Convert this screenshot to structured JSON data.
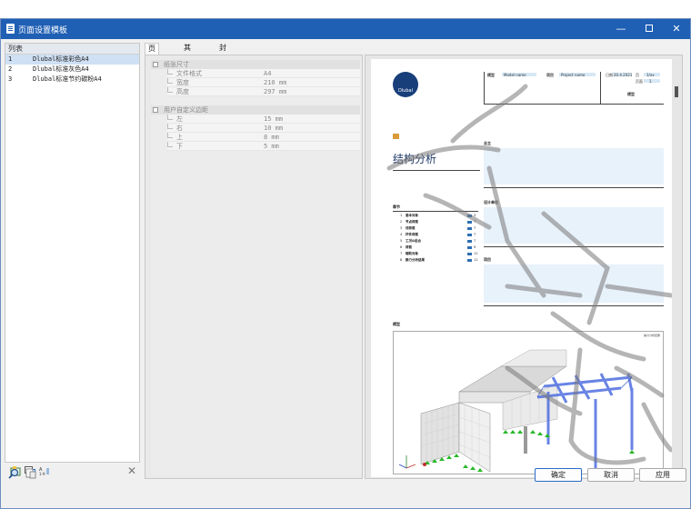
{
  "window": {
    "title": "页面设置模板"
  },
  "list": {
    "header": "列表",
    "items": [
      {
        "num": "1",
        "name": "Dlubal标准彩色A4",
        "selected": true
      },
      {
        "num": "2",
        "name": "Dlubal标准灰色A4",
        "selected": false
      },
      {
        "num": "3",
        "name": "Dlubal标准节约碳粉A4",
        "selected": false
      }
    ]
  },
  "tabs": [
    "页面设置",
    "其他设置",
    "封面设置"
  ],
  "settings": {
    "group_paper": "纸张尺寸",
    "paper_rows": [
      {
        "label": "文件格式",
        "value": "A4"
      },
      {
        "label": "宽度",
        "value": "210 mm"
      },
      {
        "label": "高度",
        "value": "297 mm"
      }
    ],
    "group_margins": "用户自定义边距",
    "margin_rows": [
      {
        "label": "左",
        "value": "15 mm"
      },
      {
        "label": "右",
        "value": "10 mm"
      },
      {
        "label": "上",
        "value": "8 mm"
      },
      {
        "label": "下",
        "value": "5 mm"
      }
    ]
  },
  "preview": {
    "logo_text": "Dlubal",
    "header_cells": {
      "label_model": "模型",
      "model_name": "Model name",
      "label_project": "项目",
      "project_name": "Project name",
      "label_date": "日期",
      "date": "20.4.2023",
      "label_page": "页",
      "page": "1/xx",
      "label_sheet": "页面",
      "sheet": "1",
      "label_title": "模型"
    },
    "big_title": "结构分析",
    "owner_label": "业主",
    "designer_label": "设计单位",
    "notes_label": "项目",
    "toc_label": "章节",
    "toc": [
      {
        "num": "1",
        "text": "基本对象",
        "page": "3"
      },
      {
        "num": "2",
        "text": "节点荷载",
        "page": "7"
      },
      {
        "num": "3",
        "text": "线荷载",
        "page": "7"
      },
      {
        "num": "4",
        "text": "杆件荷载",
        "page": "7"
      },
      {
        "num": "5",
        "text": "工况&组合",
        "page": "7"
      },
      {
        "num": "6",
        "text": "荷载",
        "page": "9"
      },
      {
        "num": "7",
        "text": "辅助对象",
        "page": "11"
      },
      {
        "num": "8",
        "text": "静力分析结果",
        "page": "11"
      }
    ],
    "model_label": "模型",
    "model_tag": "静力分析结果"
  },
  "buttons": {
    "ok": "确定",
    "cancel": "取消",
    "apply": "应用"
  },
  "colors": {
    "titlebar": "#1f5fb4",
    "selection": "#cfe0f4",
    "accent": "#2a6bc7",
    "logo": "#183f7a",
    "beam": "#4f6fe0"
  }
}
